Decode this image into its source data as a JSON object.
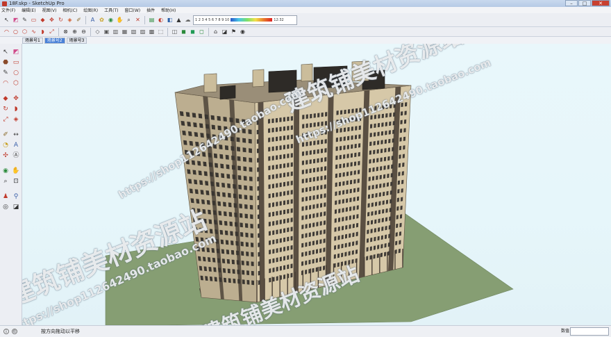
{
  "window": {
    "title": "18F.skp - SketchUp Pro",
    "controls": {
      "minimize": "–",
      "maximize": "□",
      "close": "✕"
    }
  },
  "menu": {
    "items": [
      "文件(F)",
      "编辑(E)",
      "视图(V)",
      "相机(C)",
      "绘图(R)",
      "工具(T)",
      "窗口(W)",
      "插件",
      "帮助(H)"
    ]
  },
  "toolbar1": {
    "icons": [
      {
        "name": "select-icon",
        "glyph": "↖",
        "color": "#333"
      },
      {
        "name": "eraser-icon",
        "glyph": "◩",
        "color": "#d04a8a"
      },
      {
        "name": "pencil-icon",
        "glyph": "✎",
        "color": "#444"
      },
      {
        "name": "rectangle-icon",
        "glyph": "▭",
        "color": "#c0392b"
      },
      {
        "name": "push-pull-icon",
        "glyph": "◆",
        "color": "#c0392b"
      },
      {
        "name": "move-icon",
        "glyph": "✥",
        "color": "#c0392b"
      },
      {
        "name": "rotate-icon",
        "glyph": "↻",
        "color": "#c0392b"
      },
      {
        "name": "offset-icon",
        "glyph": "◈",
        "color": "#d05a2a"
      },
      {
        "name": "tape-icon",
        "glyph": "✐",
        "color": "#8a6a2a"
      },
      {
        "name": "text-icon",
        "glyph": "A",
        "color": "#3a5fa8"
      },
      {
        "name": "paint-icon",
        "glyph": "✿",
        "color": "#c8a020"
      },
      {
        "name": "orbit-icon",
        "glyph": "◉",
        "color": "#2a8a3a"
      },
      {
        "name": "pan-icon",
        "glyph": "✋",
        "color": "#555"
      },
      {
        "name": "zoom-icon",
        "glyph": "⌕",
        "color": "#333"
      },
      {
        "name": "zoom-extents-icon",
        "glyph": "✕",
        "color": "#c0392b"
      },
      {
        "name": "component-icon",
        "glyph": "▤",
        "color": "#2a8a3a"
      },
      {
        "name": "materials-icon",
        "glyph": "◐",
        "color": "#c0392b"
      },
      {
        "name": "styles-icon",
        "glyph": "◧",
        "color": "#2a5fa8"
      },
      {
        "name": "shadows-icon",
        "glyph": "▲",
        "color": "#333"
      },
      {
        "name": "fog-icon",
        "glyph": "☁",
        "color": "#666"
      }
    ],
    "color_scale": {
      "left_label": "1 2 3 4 5 6 7 8 9 10",
      "right_label": "12:32"
    }
  },
  "toolbar2": {
    "icons": [
      {
        "name": "arc-icon",
        "glyph": "◠",
        "color": "#c0392b"
      },
      {
        "name": "circle-icon",
        "glyph": "○",
        "color": "#c0392b"
      },
      {
        "name": "polygon-icon",
        "glyph": "⬡",
        "color": "#c0392b"
      },
      {
        "name": "freehand-icon",
        "glyph": "∿",
        "color": "#c0392b"
      },
      {
        "name": "follow-me-icon",
        "glyph": "◗",
        "color": "#c0392b"
      },
      {
        "name": "scale-icon",
        "glyph": "⤢",
        "color": "#c0392b"
      },
      {
        "name": "intersect-icon",
        "glyph": "⊗",
        "color": "#333"
      },
      {
        "name": "union-icon",
        "glyph": "⊕",
        "color": "#333"
      },
      {
        "name": "subtract-icon",
        "glyph": "⊖",
        "color": "#333"
      },
      {
        "name": "iso-view-icon",
        "glyph": "◇",
        "color": "#555"
      },
      {
        "name": "top-view-icon",
        "glyph": "▣",
        "color": "#555"
      },
      {
        "name": "front-view-icon",
        "glyph": "▥",
        "color": "#555"
      },
      {
        "name": "right-view-icon",
        "glyph": "▦",
        "color": "#555"
      },
      {
        "name": "back-view-icon",
        "glyph": "▧",
        "color": "#555"
      },
      {
        "name": "left-view-icon",
        "glyph": "▨",
        "color": "#555"
      },
      {
        "name": "xray-icon",
        "glyph": "▩",
        "color": "#555"
      },
      {
        "name": "wireframe-icon",
        "glyph": "⬚",
        "color": "#555"
      },
      {
        "name": "hidden-line-icon",
        "glyph": "◫",
        "color": "#555"
      },
      {
        "name": "shaded-icon",
        "glyph": "◼",
        "color": "#2a8a3a"
      },
      {
        "name": "textured-icon",
        "glyph": "◼",
        "color": "#1f9a55"
      },
      {
        "name": "monochrome-icon",
        "glyph": "◻",
        "color": "#2a8a3a"
      },
      {
        "name": "camera-icon",
        "glyph": "⌂",
        "color": "#333"
      },
      {
        "name": "section-icon",
        "glyph": "◪",
        "color": "#333"
      },
      {
        "name": "walk-icon",
        "glyph": "⚑",
        "color": "#333"
      },
      {
        "name": "look-icon",
        "glyph": "◉",
        "color": "#333"
      }
    ]
  },
  "layer_tabs": [
    "场景号1",
    "场景号2",
    "场景号3"
  ],
  "left_toolbar": {
    "rows": [
      [
        {
          "name": "select-icon",
          "glyph": "↖",
          "color": "#333"
        },
        {
          "name": "eraser-icon",
          "glyph": "◩",
          "color": "#d04a8a"
        }
      ],
      [
        {
          "name": "paint-bucket-icon",
          "glyph": "⬣",
          "color": "#8a4a2a"
        },
        {
          "name": "rectangle-icon",
          "glyph": "▭",
          "color": "#c0392b"
        }
      ],
      [
        {
          "name": "pencil-icon",
          "glyph": "✎",
          "color": "#444"
        },
        {
          "name": "circle-icon",
          "glyph": "○",
          "color": "#c0392b"
        }
      ],
      [
        {
          "name": "arc-icon",
          "glyph": "◠",
          "color": "#c0392b"
        },
        {
          "name": "polygon-icon",
          "glyph": "⬡",
          "color": "#c0392b"
        }
      ],
      [
        {
          "name": "push-pull-icon",
          "glyph": "◆",
          "color": "#c0392b"
        },
        {
          "name": "move-icon",
          "glyph": "✥",
          "color": "#c0392b"
        }
      ],
      [
        {
          "name": "rotate-icon",
          "glyph": "↻",
          "color": "#c0392b"
        },
        {
          "name": "follow-me-icon",
          "glyph": "◗",
          "color": "#c0392b"
        }
      ],
      [
        {
          "name": "scale-icon",
          "glyph": "⤢",
          "color": "#c0392b"
        },
        {
          "name": "offset-icon",
          "glyph": "◈",
          "color": "#c0392b"
        }
      ],
      [
        {
          "name": "tape-icon",
          "glyph": "✐",
          "color": "#8a6a2a"
        },
        {
          "name": "dimension-icon",
          "glyph": "↔",
          "color": "#444"
        }
      ],
      [
        {
          "name": "protractor-icon",
          "glyph": "◔",
          "color": "#c8a020"
        },
        {
          "name": "text-icon",
          "glyph": "A",
          "color": "#3a5fa8"
        }
      ],
      [
        {
          "name": "axes-icon",
          "glyph": "✣",
          "color": "#c0392b"
        },
        {
          "name": "3d-text-icon",
          "glyph": "Ⓐ",
          "color": "#444"
        }
      ],
      [
        {
          "name": "orbit-icon",
          "glyph": "◉",
          "color": "#2a8a3a"
        },
        {
          "name": "pan-icon",
          "glyph": "✋",
          "color": "#555"
        }
      ],
      [
        {
          "name": "zoom-icon",
          "glyph": "⌕",
          "color": "#333"
        },
        {
          "name": "zoom-window-icon",
          "glyph": "⊡",
          "color": "#333"
        }
      ],
      [
        {
          "name": "position-camera-icon",
          "glyph": "♟",
          "color": "#c0392b"
        },
        {
          "name": "walk-icon",
          "glyph": "⚲",
          "color": "#3a5fa8"
        }
      ],
      [
        {
          "name": "look-around-icon",
          "glyph": "◎",
          "color": "#333"
        },
        {
          "name": "section-plane-icon",
          "glyph": "◪",
          "color": "#333"
        }
      ]
    ]
  },
  "status": {
    "message": "按方向拖动以平移",
    "measurements_label": "数值",
    "measurements_value": ""
  },
  "watermarks": [
    "建筑铺美材资源站",
    "https://shop112642490.taobao.com",
    "建筑铺美材资源站",
    "https://shop112642490.taobao.com",
    "建筑铺美材资源站",
    "https://shop112642490.taobao.com"
  ]
}
